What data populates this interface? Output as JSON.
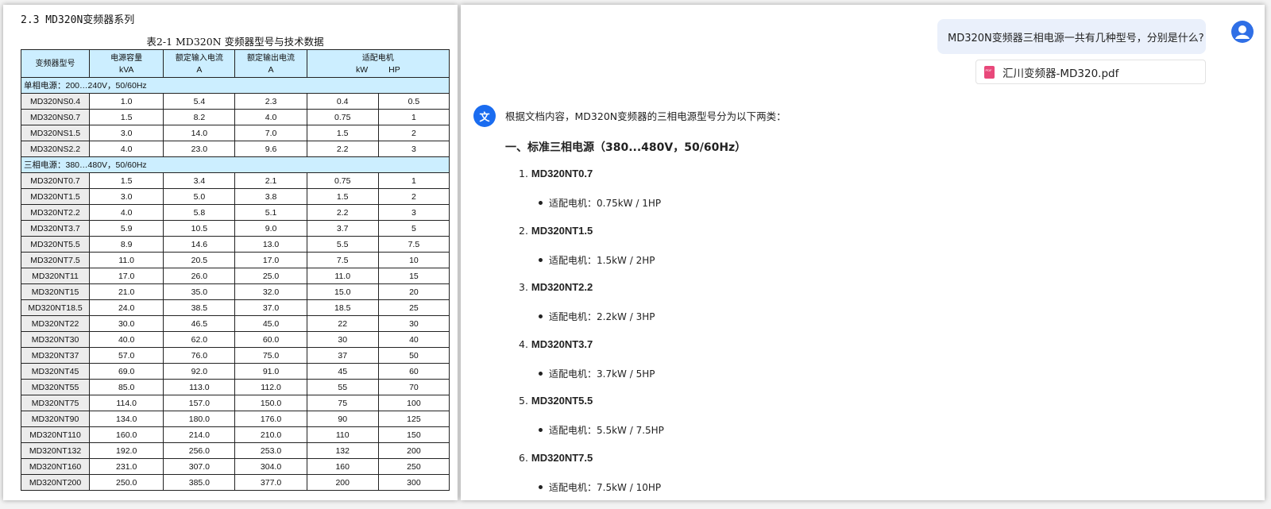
{
  "document": {
    "section_title": "2.3 MD320N变频器系列",
    "table_caption": "表2-1 MD320N 变频器型号与技术数据",
    "headers": {
      "model": "变频器型号",
      "capacity": "电源容量",
      "capacity_unit": "kVA",
      "input_current": "额定输入电流",
      "input_unit": "A",
      "output_current": "额定输出电流",
      "output_unit": "A",
      "motor": "适配电机",
      "motor_kw": "kW",
      "motor_hp": "HP"
    },
    "groups": [
      {
        "label": "单相电源：200…240V，50/60Hz",
        "rows": [
          [
            "MD320NS0.4",
            "1.0",
            "5.4",
            "2.3",
            "0.4",
            "0.5"
          ],
          [
            "MD320NS0.7",
            "1.5",
            "8.2",
            "4.0",
            "0.75",
            "1"
          ],
          [
            "MD320NS1.5",
            "3.0",
            "14.0",
            "7.0",
            "1.5",
            "2"
          ],
          [
            "MD320NS2.2",
            "4.0",
            "23.0",
            "9.6",
            "2.2",
            "3"
          ]
        ]
      },
      {
        "label": "三相电源：380…480V，50/60Hz",
        "rows": [
          [
            "MD320NT0.7",
            "1.5",
            "3.4",
            "2.1",
            "0.75",
            "1"
          ],
          [
            "MD320NT1.5",
            "3.0",
            "5.0",
            "3.8",
            "1.5",
            "2"
          ],
          [
            "MD320NT2.2",
            "4.0",
            "5.8",
            "5.1",
            "2.2",
            "3"
          ],
          [
            "MD320NT3.7",
            "5.9",
            "10.5",
            "9.0",
            "3.7",
            "5"
          ],
          [
            "MD320NT5.5",
            "8.9",
            "14.6",
            "13.0",
            "5.5",
            "7.5"
          ],
          [
            "MD320NT7.5",
            "11.0",
            "20.5",
            "17.0",
            "7.5",
            "10"
          ],
          [
            "MD320NT11",
            "17.0",
            "26.0",
            "25.0",
            "11.0",
            "15"
          ],
          [
            "MD320NT15",
            "21.0",
            "35.0",
            "32.0",
            "15.0",
            "20"
          ],
          [
            "MD320NT18.5",
            "24.0",
            "38.5",
            "37.0",
            "18.5",
            "25"
          ],
          [
            "MD320NT22",
            "30.0",
            "46.5",
            "45.0",
            "22",
            "30"
          ],
          [
            "MD320NT30",
            "40.0",
            "62.0",
            "60.0",
            "30",
            "40"
          ],
          [
            "MD320NT37",
            "57.0",
            "76.0",
            "75.0",
            "37",
            "50"
          ],
          [
            "MD320NT45",
            "69.0",
            "92.0",
            "91.0",
            "45",
            "60"
          ],
          [
            "MD320NT55",
            "85.0",
            "113.0",
            "112.0",
            "55",
            "70"
          ],
          [
            "MD320NT75",
            "114.0",
            "157.0",
            "150.0",
            "75",
            "100"
          ],
          [
            "MD320NT90",
            "134.0",
            "180.0",
            "176.0",
            "90",
            "125"
          ],
          [
            "MD320NT110",
            "160.0",
            "214.0",
            "210.0",
            "110",
            "150"
          ],
          [
            "MD320NT132",
            "192.0",
            "256.0",
            "253.0",
            "132",
            "200"
          ],
          [
            "MD320NT160",
            "231.0",
            "307.0",
            "304.0",
            "160",
            "250"
          ],
          [
            "MD320NT200",
            "250.0",
            "385.0",
            "377.0",
            "200",
            "300"
          ]
        ]
      }
    ]
  },
  "chat": {
    "user_question": "MD320N变频器三相电源一共有几种型号，分别是什么?",
    "attachment_name": "汇川变频器-MD320.pdf",
    "attachment_icon": "pdf-icon",
    "bot_avatar_text": "文",
    "intro": "根据文档内容，MD320N变频器的三相电源型号分为以下两类：",
    "heading": "一、标准三相电源（380...480V，50/60Hz）",
    "models": [
      {
        "index": "1.",
        "name": "MD320NT0.7",
        "motor": "适配电机：0.75kW / 1HP"
      },
      {
        "index": "2.",
        "name": "MD320NT1.5",
        "motor": "适配电机：1.5kW / 2HP"
      },
      {
        "index": "3.",
        "name": "MD320NT2.2",
        "motor": "适配电机：2.2kW / 3HP"
      },
      {
        "index": "4.",
        "name": "MD320NT3.7",
        "motor": "适配电机：3.7kW / 5HP"
      },
      {
        "index": "5.",
        "name": "MD320NT5.5",
        "motor": "适配电机：5.5kW / 7.5HP"
      },
      {
        "index": "6.",
        "name": "MD320NT7.5",
        "motor": "适配电机：7.5kW / 10HP"
      }
    ]
  },
  "colors": {
    "table_header_bg": "#cceeff",
    "user_bubble_bg": "#eaf0fb",
    "avatar_blue": "#1a6cf0",
    "pdf_icon": "#e8487a"
  }
}
